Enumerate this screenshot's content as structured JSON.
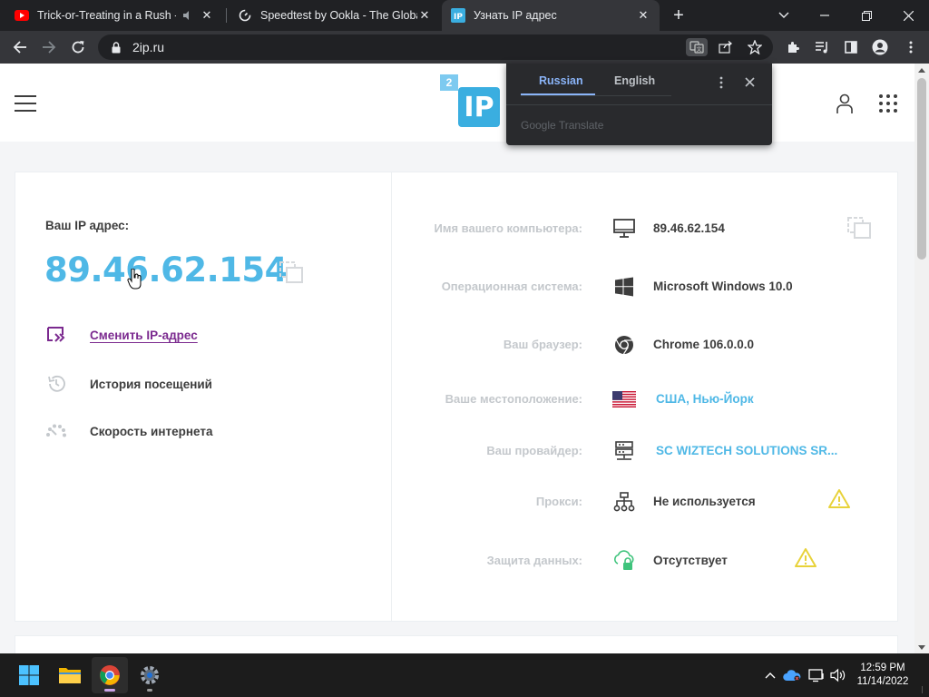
{
  "browser": {
    "tabs": [
      {
        "title": "Trick-or-Treating in a Rush -",
        "favicon": "youtube-icon",
        "audio": true,
        "active": false
      },
      {
        "title": "Speedtest by Ookla - The Global",
        "favicon": "speedtest-icon",
        "active": false
      },
      {
        "title": "Узнать IP адрес",
        "favicon": "2ip-icon",
        "active": true
      }
    ],
    "url": "2ip.ru"
  },
  "translate_popup": {
    "tabs": [
      "Russian",
      "English"
    ],
    "selected": "Russian",
    "brand": "Google Translate"
  },
  "site": {
    "ip_label": "Ваш IP адрес:",
    "ip_value": "89.46.62.154",
    "actions": [
      {
        "label": "Сменить IP-адрес",
        "icon": "change-ip-icon"
      },
      {
        "label": "История посещений",
        "icon": "history-icon"
      },
      {
        "label": "Скорость интернета",
        "icon": "speedometer-icon"
      }
    ],
    "info": [
      {
        "label": "Имя вашего компьютера:",
        "icon": "monitor-icon",
        "value": "89.46.62.154"
      },
      {
        "label": "Операционная система:",
        "icon": "windows-icon",
        "value": "Microsoft Windows 10.0"
      },
      {
        "label": "Ваш браузер:",
        "icon": "chrome-icon",
        "value": "Chrome 106.0.0.0"
      },
      {
        "label": "Ваше местоположение:",
        "icon": "us-flag-icon",
        "value": "США, Нью-Йорк"
      },
      {
        "label": "Ваш провайдер:",
        "icon": "server-icon",
        "value": "SC WIZTECH SOLUTIONS SR..."
      },
      {
        "label": "Прокси:",
        "icon": "network-icon",
        "value": "Не используется",
        "warning": true
      },
      {
        "label": "Защита данных:",
        "icon": "cloud-lock-icon",
        "value": "Отсутствует",
        "warning": true
      }
    ]
  },
  "taskbar": {
    "time": "12:59 PM",
    "date": "11/14/2022"
  },
  "colors": {
    "accent_blue": "#4fb8e6",
    "link_purple": "#7b2a8f",
    "warning_yellow": "#e8d23a"
  }
}
